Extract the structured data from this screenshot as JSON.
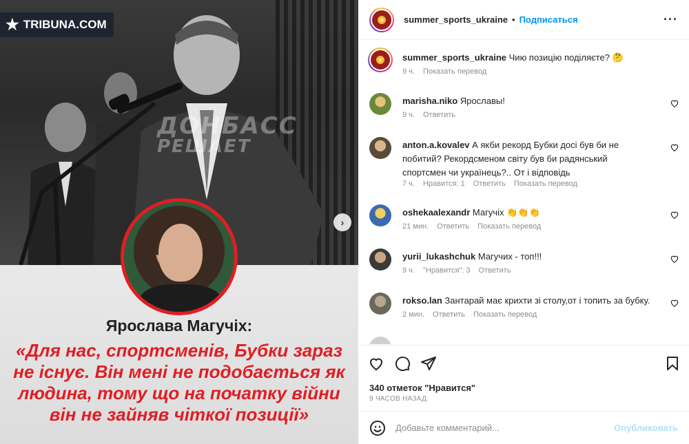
{
  "media": {
    "logo_text": "TRIBUNA.COM",
    "watermark_line1": "ДОНБАСС",
    "watermark_line2": "РЕШАЕТ",
    "quote_name": "Ярослава Магучіх:",
    "quote_text": "«Для нас, спортсменів, Бубки зараз не існує. Він мені не подобається як людина, тому що на початку війни він не зайняв чіткої позиції»",
    "carousel_next": "›"
  },
  "header": {
    "username": "summer_sports_ukraine",
    "separator": "•",
    "follow_label": "Подписаться",
    "more_label": "···"
  },
  "caption": {
    "username": "summer_sports_ukraine",
    "text": "Чию позицію поділяєте? 🤔",
    "time": "9 ч.",
    "translate": "Показать перевод"
  },
  "comments": [
    {
      "username": "marisha.niko",
      "text": "Ярославы!",
      "time": "9 ч.",
      "likes": "",
      "reply": "Ответить",
      "translate": ""
    },
    {
      "username": "anton.a.kovalev",
      "text": "А якби рекорд Бубки досі був би не побитий? Рекордсменом світу був би радянський спортсмен чи українець?.. От і відповідь",
      "time": "7 ч.",
      "likes": "Нравится: 1",
      "reply": "Ответить",
      "translate": "Показать перевод"
    },
    {
      "username": "oshekaalexandr",
      "text": "Магучіх 👏👏👏",
      "time": "21 мин.",
      "likes": "",
      "reply": "Ответить",
      "translate": "Показать перевод"
    },
    {
      "username": "yurii_lukashchuk",
      "text": "Магучих - топ!!!",
      "time": "9 ч.",
      "likes": "\"Нравится\": 3",
      "reply": "Ответить",
      "translate": ""
    },
    {
      "username": "rokso.lan",
      "text": "Зантарай має крихти зі столу,от і топить за бубку.",
      "time": "2 мин.",
      "likes": "",
      "reply": "Ответить",
      "translate": "Показать перевод"
    }
  ],
  "footer": {
    "likes_count": "340 отметок \"Нравится\"",
    "posted_ago": "9 ЧАСОВ НАЗАД",
    "comment_placeholder": "Добавьте комментарий...",
    "post_label": "Опубликовать"
  },
  "colors": {
    "accent_blue": "#0095f6",
    "quote_red": "#e01e24",
    "meta_grey": "#8e8e8e"
  },
  "icons": [
    "heart-icon",
    "comment-icon",
    "share-icon",
    "bookmark-icon",
    "emoji-icon",
    "more-options-icon",
    "chevron-right-icon"
  ]
}
